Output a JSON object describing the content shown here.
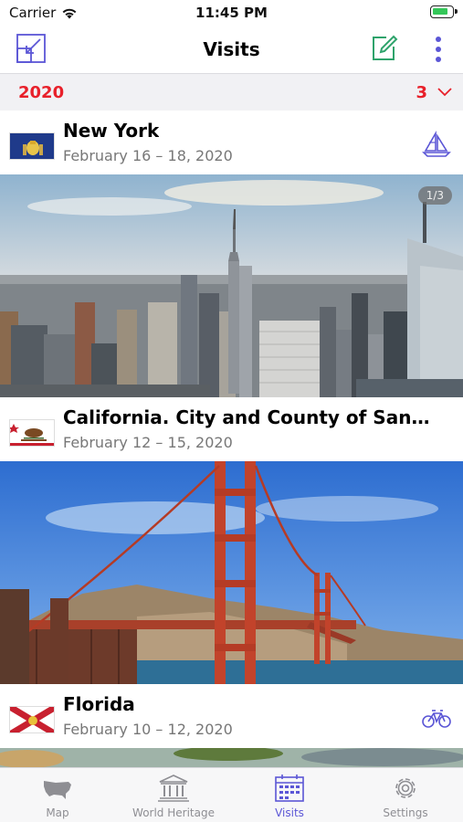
{
  "status_bar": {
    "carrier": "Carrier",
    "time": "11:45 PM"
  },
  "nav": {
    "title": "Visits",
    "accent_color": "#5b56d6"
  },
  "section": {
    "year": "2020",
    "count": "3",
    "color": "#e8202a"
  },
  "visits": [
    {
      "name": "New York",
      "dates": "February 16 – 18, 2020",
      "transport": "sailboat-icon",
      "photo_counter": "1/3"
    },
    {
      "name": "California. City and County of San…",
      "dates": "February 12 – 15, 2020",
      "transport": ""
    },
    {
      "name": "Florida",
      "dates": "February 10 – 12, 2020",
      "transport": "bicycle-icon"
    }
  ],
  "tabs": [
    {
      "label": "Map",
      "icon": "usa-map-icon",
      "active": false
    },
    {
      "label": "World Heritage",
      "icon": "temple-icon",
      "active": false
    },
    {
      "label": "Visits",
      "icon": "calendar-icon",
      "active": true
    },
    {
      "label": "Settings",
      "icon": "gear-icon",
      "active": false
    }
  ]
}
